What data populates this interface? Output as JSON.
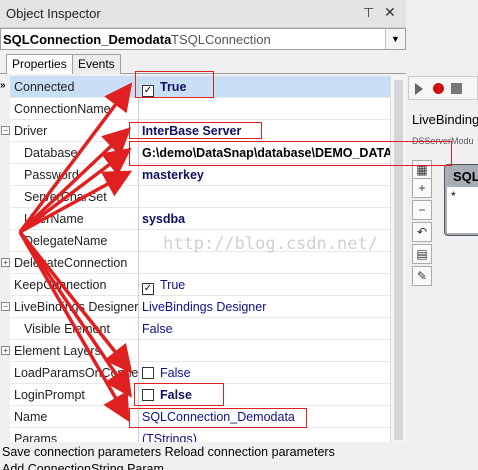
{
  "window": {
    "title": "Object Inspector"
  },
  "selector": {
    "name": "SQLConnection_Demodata",
    "type": "TSQLConnection"
  },
  "tabs": [
    "Properties",
    "Events"
  ],
  "marker": "»",
  "properties": [
    {
      "name": "Connected",
      "value": "True",
      "checkbox": true,
      "checked": true,
      "bold": true,
      "selected": true
    },
    {
      "name": "ConnectionName",
      "value": ""
    },
    {
      "name": "Driver",
      "value": "InterBase Server",
      "bold": true,
      "expander": "⊟"
    },
    {
      "name": "Database",
      "value": "G:\\demo\\DataSnap\\database\\DEMO_DATA.GDB",
      "bold": true,
      "black": true
    },
    {
      "name": "Password",
      "value": "masterkey",
      "bold": true
    },
    {
      "name": "ServerCharSet",
      "value": ""
    },
    {
      "name": "UserName",
      "value": "sysdba",
      "bold": true
    },
    {
      "name": "DelegateName",
      "value": ""
    },
    {
      "name": "DelegateConnection",
      "value": "",
      "expander": "⊞"
    },
    {
      "name": "KeepConnection",
      "value": "True",
      "checkbox": true,
      "checked": true
    },
    {
      "name": "LiveBindings Designer",
      "value": "LiveBindings Designer",
      "expander": "⊟"
    },
    {
      "name": "Visible Element",
      "value": "False"
    },
    {
      "name": "Element Layers",
      "value": "",
      "expander": "⊞"
    },
    {
      "name": "LoadParamsOnConne",
      "value": "False",
      "checkbox": true,
      "checked": false
    },
    {
      "name": "LoginPrompt",
      "value": "False",
      "checkbox": true,
      "checked": false,
      "bold": true
    },
    {
      "name": "Name",
      "value": "SQLConnection_Demodata"
    },
    {
      "name": "Params",
      "value": "(TStrings)"
    }
  ],
  "status": {
    "line1": "Save connection parameters  Reload connection parameters",
    "line2": "Add ConnectionString Param"
  },
  "designer": {
    "title": "LiveBindings",
    "subtitle": "DSServerModu",
    "node_title": "SQL",
    "node_item": "*",
    "tools": [
      "plus-icon",
      "minus-icon",
      "undo-icon",
      "grid-icon",
      "wand-icon"
    ]
  },
  "watermark": "http://blog.csdn.net/",
  "colors": {
    "annotation": "#e02020",
    "selection": "#c9dff5",
    "value_text": "#10108a"
  }
}
